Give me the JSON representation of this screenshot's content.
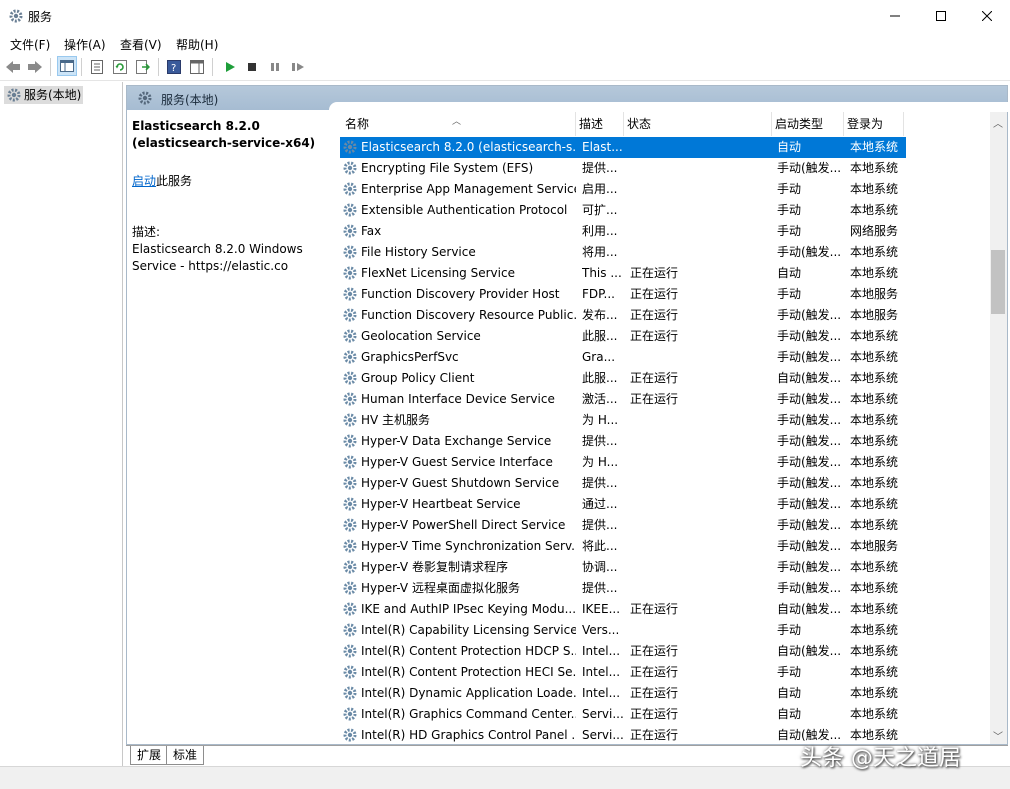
{
  "window": {
    "title": "服务"
  },
  "menu": [
    "文件(F)",
    "操作(A)",
    "查看(V)",
    "帮助(H)"
  ],
  "tree": {
    "item": "服务(本地)"
  },
  "banner": {
    "title": "服务(本地)"
  },
  "details": {
    "title": "Elasticsearch 8.2.0 (elasticsearch-service-x64)",
    "start_link": "启动",
    "start_suffix": "此服务",
    "desc_label": "描述:",
    "desc_text": "Elasticsearch 8.2.0 Windows Service - https://elastic.co"
  },
  "columns": [
    "名称",
    "描述",
    "状态",
    "启动类型",
    "登录为"
  ],
  "services": [
    {
      "name": "Elasticsearch 8.2.0 (elasticsearch-s...",
      "desc": "Elast...",
      "status": "",
      "startup": "自动",
      "logon": "本地系统",
      "selected": true
    },
    {
      "name": "Encrypting File System (EFS)",
      "desc": "提供...",
      "status": "",
      "startup": "手动(触发...",
      "logon": "本地系统"
    },
    {
      "name": "Enterprise App Management Service",
      "desc": "启用...",
      "status": "",
      "startup": "手动",
      "logon": "本地系统"
    },
    {
      "name": "Extensible Authentication Protocol",
      "desc": "可扩...",
      "status": "",
      "startup": "手动",
      "logon": "本地系统"
    },
    {
      "name": "Fax",
      "desc": "利用...",
      "status": "",
      "startup": "手动",
      "logon": "网络服务"
    },
    {
      "name": "File History Service",
      "desc": "将用...",
      "status": "",
      "startup": "手动(触发...",
      "logon": "本地系统"
    },
    {
      "name": "FlexNet Licensing Service",
      "desc": "This ...",
      "status": "正在运行",
      "startup": "自动",
      "logon": "本地系统"
    },
    {
      "name": "Function Discovery Provider Host",
      "desc": "FDP...",
      "status": "正在运行",
      "startup": "手动",
      "logon": "本地服务"
    },
    {
      "name": "Function Discovery Resource Public...",
      "desc": "发布...",
      "status": "正在运行",
      "startup": "手动(触发...",
      "logon": "本地服务"
    },
    {
      "name": "Geolocation Service",
      "desc": "此服...",
      "status": "正在运行",
      "startup": "手动(触发...",
      "logon": "本地系统"
    },
    {
      "name": "GraphicsPerfSvc",
      "desc": "Gra...",
      "status": "",
      "startup": "手动(触发...",
      "logon": "本地系统"
    },
    {
      "name": "Group Policy Client",
      "desc": "此服...",
      "status": "正在运行",
      "startup": "自动(触发...",
      "logon": "本地系统"
    },
    {
      "name": "Human Interface Device Service",
      "desc": "激活...",
      "status": "正在运行",
      "startup": "手动(触发...",
      "logon": "本地系统"
    },
    {
      "name": "HV 主机服务",
      "desc": "为 H...",
      "status": "",
      "startup": "手动(触发...",
      "logon": "本地系统"
    },
    {
      "name": "Hyper-V Data Exchange Service",
      "desc": "提供...",
      "status": "",
      "startup": "手动(触发...",
      "logon": "本地系统"
    },
    {
      "name": "Hyper-V Guest Service Interface",
      "desc": "为 H...",
      "status": "",
      "startup": "手动(触发...",
      "logon": "本地系统"
    },
    {
      "name": "Hyper-V Guest Shutdown Service",
      "desc": "提供...",
      "status": "",
      "startup": "手动(触发...",
      "logon": "本地系统"
    },
    {
      "name": "Hyper-V Heartbeat Service",
      "desc": "通过...",
      "status": "",
      "startup": "手动(触发...",
      "logon": "本地系统"
    },
    {
      "name": "Hyper-V PowerShell Direct Service",
      "desc": "提供...",
      "status": "",
      "startup": "手动(触发...",
      "logon": "本地系统"
    },
    {
      "name": "Hyper-V Time Synchronization Serv...",
      "desc": "将此...",
      "status": "",
      "startup": "手动(触发...",
      "logon": "本地服务"
    },
    {
      "name": "Hyper-V 卷影复制请求程序",
      "desc": "协调...",
      "status": "",
      "startup": "手动(触发...",
      "logon": "本地系统"
    },
    {
      "name": "Hyper-V 远程桌面虚拟化服务",
      "desc": "提供...",
      "status": "",
      "startup": "手动(触发...",
      "logon": "本地系统"
    },
    {
      "name": "IKE and AuthIP IPsec Keying Modu...",
      "desc": "IKEE...",
      "status": "正在运行",
      "startup": "自动(触发...",
      "logon": "本地系统"
    },
    {
      "name": "Intel(R) Capability Licensing Service...",
      "desc": "Vers...",
      "status": "",
      "startup": "手动",
      "logon": "本地系统"
    },
    {
      "name": "Intel(R) Content Protection HDCP S...",
      "desc": "Intel...",
      "status": "正在运行",
      "startup": "自动(触发...",
      "logon": "本地系统"
    },
    {
      "name": "Intel(R) Content Protection HECI Se...",
      "desc": "Intel...",
      "status": "正在运行",
      "startup": "手动",
      "logon": "本地系统"
    },
    {
      "name": "Intel(R) Dynamic Application Loade...",
      "desc": "Intel...",
      "status": "正在运行",
      "startup": "自动",
      "logon": "本地系统"
    },
    {
      "name": "Intel(R) Graphics Command Center...",
      "desc": "Servi...",
      "status": "正在运行",
      "startup": "自动",
      "logon": "本地系统"
    },
    {
      "name": "Intel(R) HD Graphics Control Panel ...",
      "desc": "Servi...",
      "status": "正在运行",
      "startup": "自动(触发...",
      "logon": "本地系统"
    }
  ],
  "tabs": [
    "扩展",
    "标准"
  ],
  "watermark": "头条 @天之道居"
}
